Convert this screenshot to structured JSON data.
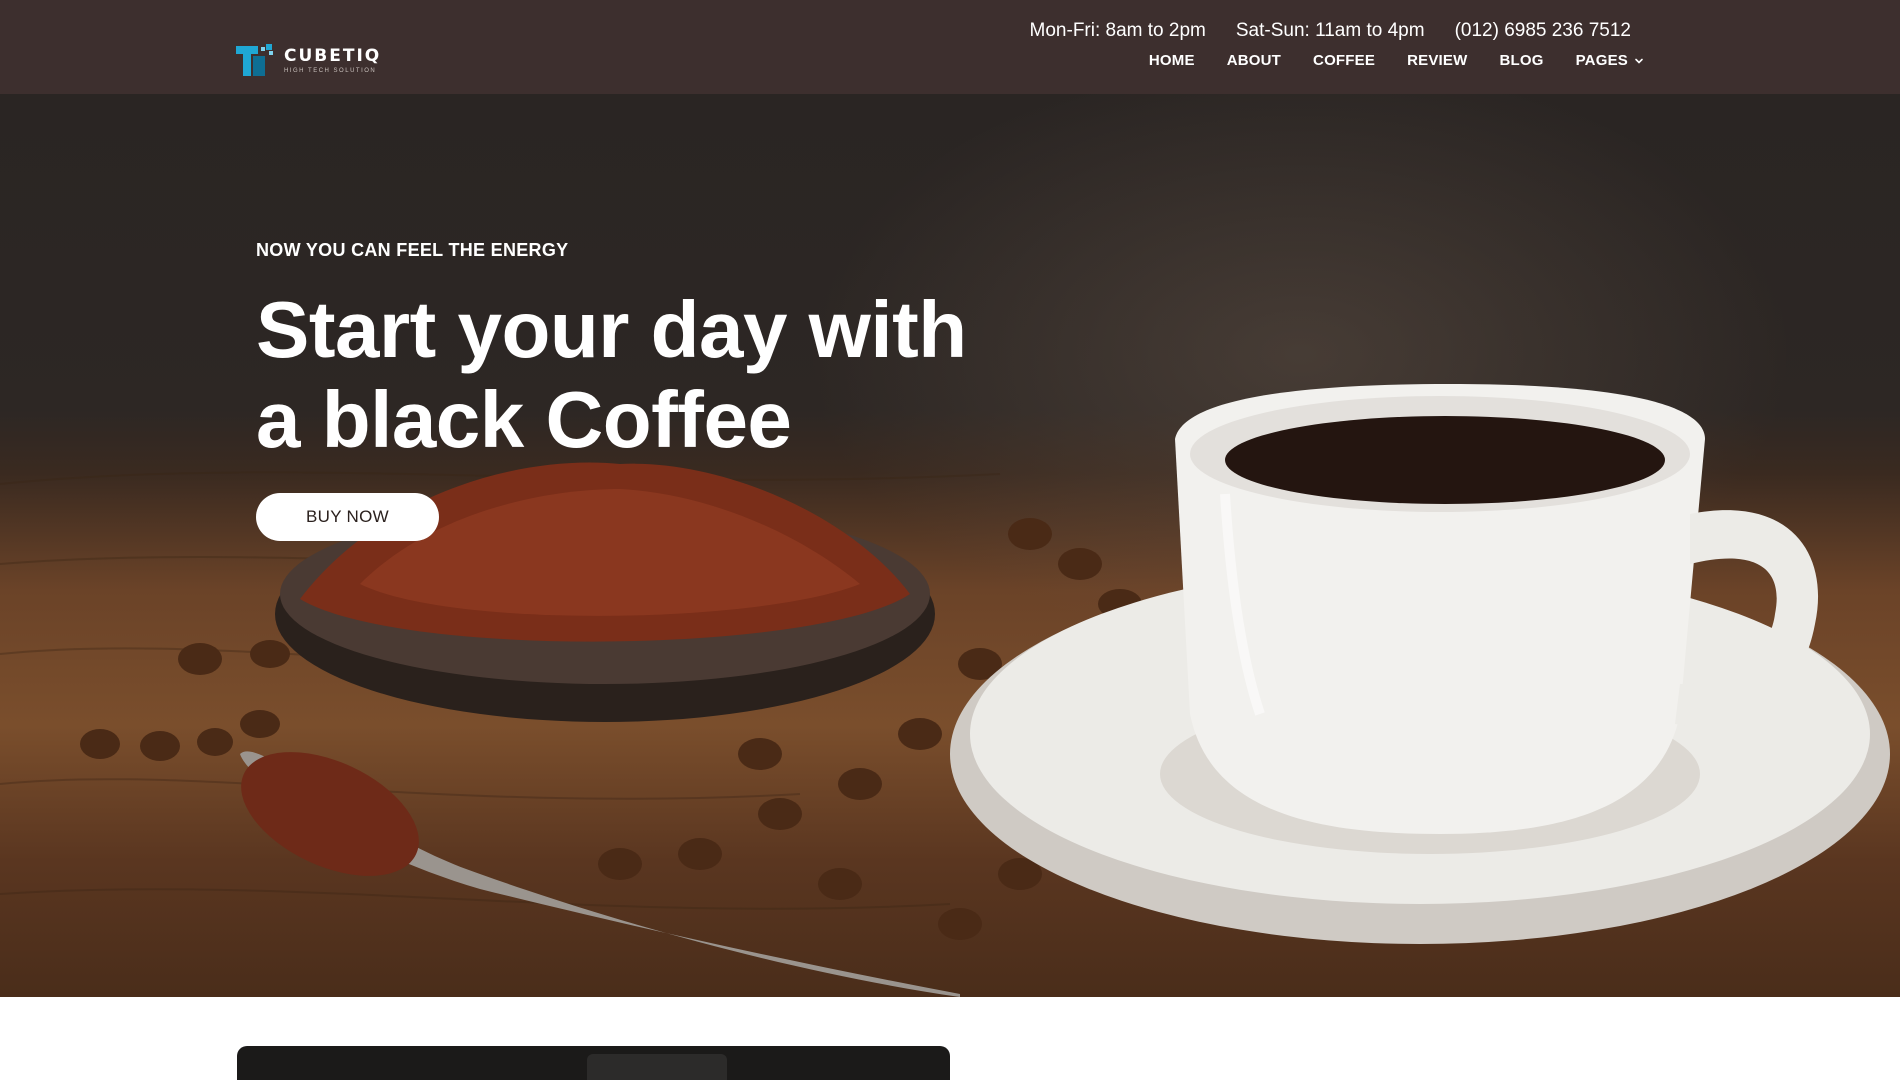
{
  "brand": {
    "name": "CUBETIQ",
    "tagline": "HIGH TECH SOLUTION",
    "accent": "#1fa7d4"
  },
  "header": {
    "background": "#3d2f2e",
    "hours": [
      "Mon-Fri: 8am to 2pm",
      "Sat-Sun: 11am to 4pm"
    ],
    "phone": "(012) 6985 236 7512",
    "nav": [
      {
        "label": "HOME"
      },
      {
        "label": "ABOUT"
      },
      {
        "label": "COFFEE"
      },
      {
        "label": "REVIEW"
      },
      {
        "label": "BLOG"
      },
      {
        "label": "PAGES",
        "icon": "chevron-down-icon"
      }
    ]
  },
  "hero": {
    "eyebrow": "NOW YOU CAN FEEL THE ENERGY",
    "headline_line1": "Start your day with",
    "headline_line2": "a black Coffee",
    "cta_label": "BUY NOW",
    "image": "coffee-cup-beans-photo"
  }
}
